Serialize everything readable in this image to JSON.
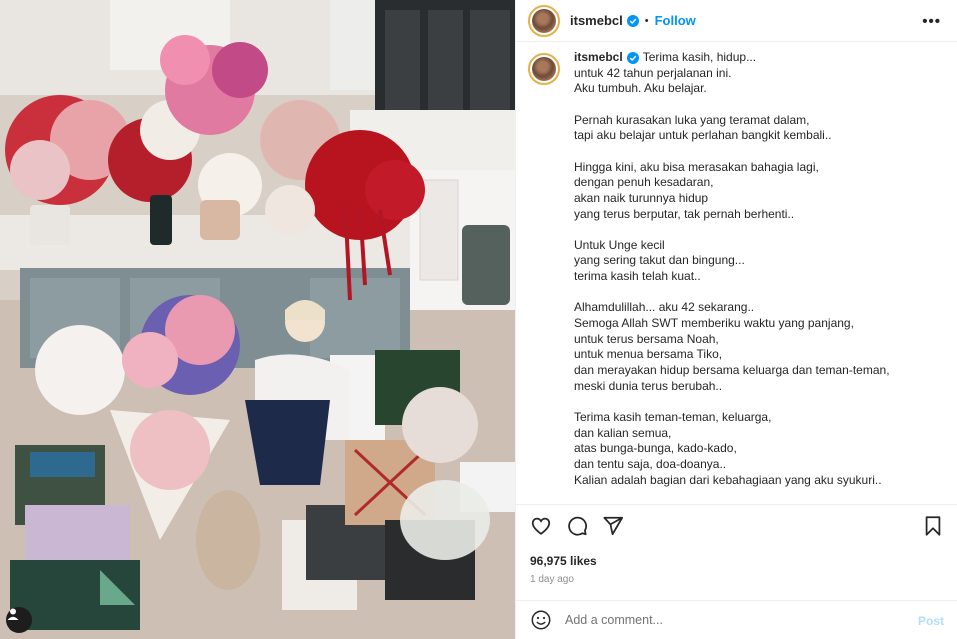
{
  "post": {
    "username": "itsmebcl",
    "verified": true,
    "follow_label": "Follow",
    "separator": "•",
    "more_label": "•••"
  },
  "caption": {
    "username": "itsmebcl",
    "first_line": "Terima kasih, hidup...",
    "lines": [
      "untuk 42 tahun perjalanan ini.",
      "Aku tumbuh. Aku belajar.",
      "",
      "Pernah kurasakan luka yang teramat dalam,",
      "tapi aku belajar untuk perlahan bangkit kembali..",
      "",
      "Hingga kini, aku bisa merasakan bahagia lagi,",
      "dengan penuh kesadaran,",
      "akan naik turunnya hidup",
      "yang terus berputar, tak pernah berhenti..",
      "",
      "Untuk Unge kecil",
      "yang sering takut dan bingung...",
      "terima kasih telah kuat..",
      "",
      "Alhamdulillah... aku 42 sekarang..",
      "Semoga Allah SWT memberiku waktu yang panjang,",
      "untuk terus bersama Noah,",
      "untuk menua bersama Tiko,",
      "dan merayakan hidup bersama keluarga dan teman-teman,",
      "meski dunia terus berubah..",
      "",
      "Terima kasih teman-teman, keluarga,",
      "dan kalian semua,",
      "atas bunga-bunga, kado-kado,",
      "dan tentu saja, doa-doanya..",
      "Kalian adalah bagian dari kebahagiaan yang aku syukuri.."
    ]
  },
  "stats": {
    "likes": "96,975 likes",
    "time_ago": "1 day ago"
  },
  "comment": {
    "placeholder": "Add a comment...",
    "post_label": "Post"
  },
  "icons": {
    "like": "heart-icon",
    "comment": "comment-icon",
    "share": "share-icon",
    "save": "bookmark-icon",
    "emoji": "emoji-icon",
    "user_tag": "user-tag-icon",
    "verified": "verified-badge-icon"
  },
  "colors": {
    "accent": "#0095f6",
    "verified": "#0095f6",
    "post_disabled": "#b2dffc",
    "muted": "#8e8e8e"
  }
}
